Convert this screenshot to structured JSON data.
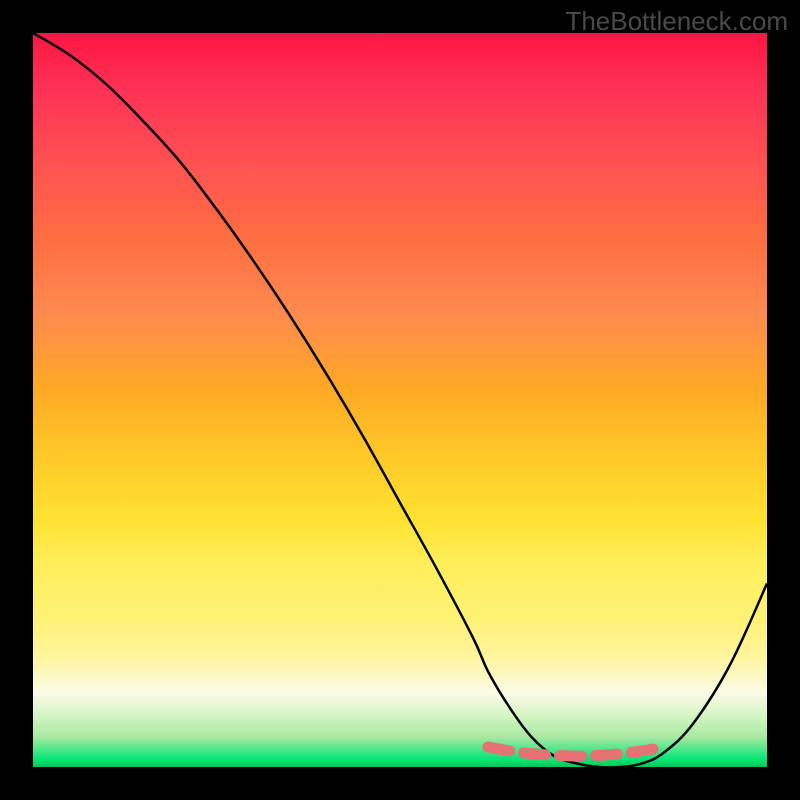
{
  "watermark": "TheBottleneck.com",
  "chart_data": {
    "type": "line",
    "title": "",
    "xlabel": "",
    "ylabel": "",
    "xlim": [
      0,
      100
    ],
    "ylim": [
      0,
      100
    ],
    "grid": false,
    "series": [
      {
        "name": "bottleneck-curve",
        "x": [
          0,
          5,
          10,
          15,
          20,
          25,
          30,
          35,
          40,
          45,
          50,
          55,
          60,
          62,
          65,
          68,
          71,
          74,
          77,
          80,
          83,
          86,
          90,
          95,
          100
        ],
        "y": [
          100,
          97,
          93,
          88,
          82.5,
          76,
          69,
          61.5,
          53.5,
          45,
          36,
          27,
          17.5,
          13,
          8,
          4,
          1.5,
          0.5,
          0,
          0,
          0.5,
          2,
          6,
          14,
          25
        ]
      }
    ],
    "annotations": [
      {
        "name": "optimal-range-marker",
        "type": "dashed-segment",
        "x_range": [
          62,
          86
        ],
        "y": 0,
        "color": "#e57373"
      }
    ],
    "background": {
      "type": "vertical-gradient",
      "stops": [
        {
          "pos": 0.0,
          "color": "#ff1744"
        },
        {
          "pos": 0.5,
          "color": "#ffca28"
        },
        {
          "pos": 0.85,
          "color": "#fff59d"
        },
        {
          "pos": 1.0,
          "color": "#00c853"
        }
      ]
    }
  }
}
